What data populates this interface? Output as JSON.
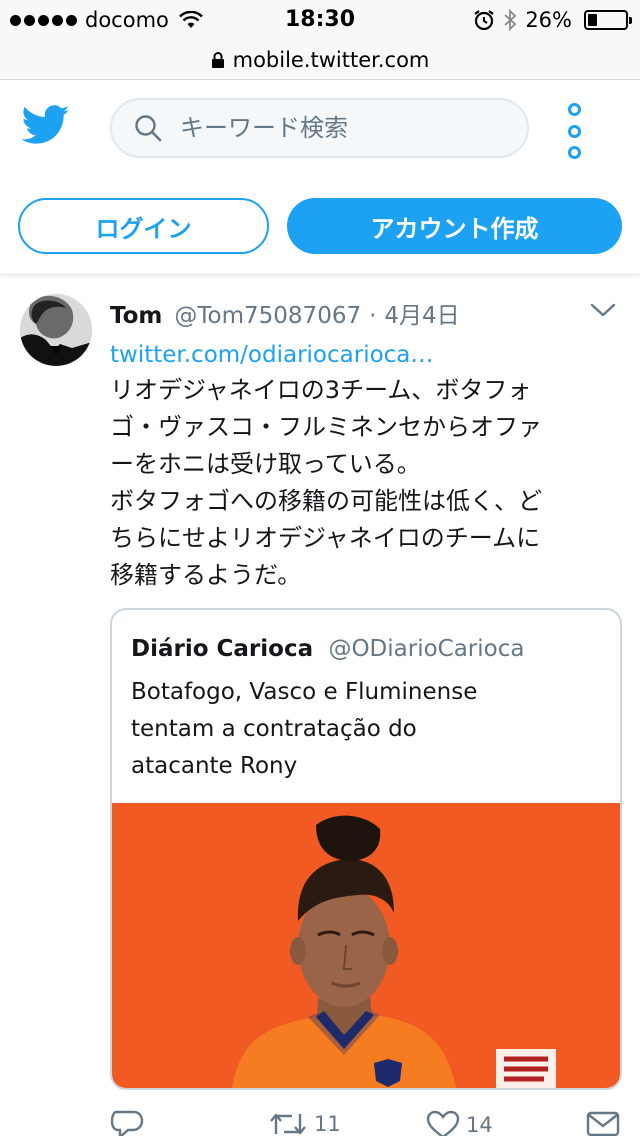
{
  "status_bar": {
    "carrier": "docomo",
    "time": "18:30",
    "battery_text": "26%",
    "battery_level": 0.26
  },
  "url_bar": {
    "url": "mobile.twitter.com"
  },
  "header": {
    "search_placeholder": "キーワード検索",
    "login_label": "ログイン",
    "signup_label": "アカウント作成",
    "accent_color": "#1da1f2"
  },
  "tweet": {
    "name": "Tom",
    "handle": "@Tom75087067",
    "separator": "·",
    "date": "4月4日",
    "link": "twitter.com/odiariocarioca…",
    "text_lines": [
      "リオデジャネイロの3チーム、ボタフォ",
      "ゴ・ヴァスコ・フルミネンセからオファ",
      "ーをホニは受け取っている。",
      "ボタフォゴへの移籍の可能性は低く、ど",
      "ちらにせよリオデジャネイロのチームに",
      "移籍するようだ。"
    ],
    "quote": {
      "name": "Diário Carioca",
      "handle": "@ODiarioCarioca",
      "text_lines": [
        "Botafogo, Vasco e Fluminense",
        "tentam a contratação do",
        "atacante Rony"
      ],
      "image_bg_color": "#f15a22"
    },
    "actions": {
      "reply_count": "",
      "retweet_count": "11",
      "like_count": "14"
    }
  }
}
